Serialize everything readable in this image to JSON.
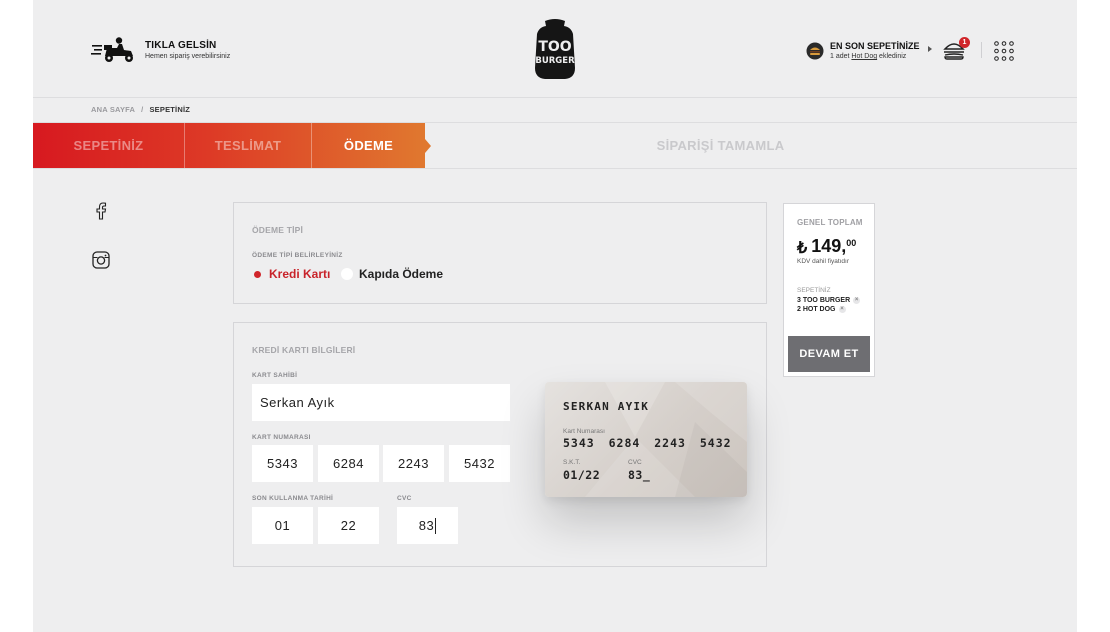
{
  "header": {
    "delivery_title": "TIKLA GELSİN",
    "delivery_sub": "Hemen sipariş verebilirsiniz",
    "logo_line1": "TOO",
    "logo_line2": "BURGER",
    "last_cart_title": "EN SON SEPETİNİZE",
    "last_cart_sub_pre": "1 adet ",
    "last_cart_sub_item": "Hot Dog",
    "last_cart_sub_post": " eklediniz",
    "cart_count": "1",
    "icons": [
      "scooter-icon",
      "burger-avatar-icon",
      "arrow-right-icon",
      "burger-cart-icon",
      "grid-menu-icon"
    ]
  },
  "breadcrumb": {
    "home": "ANA SAYFA",
    "sep": "/",
    "current": "SEPETİNİZ"
  },
  "steps": [
    {
      "label": "SEPETİNİZ",
      "state": "done"
    },
    {
      "label": "TESLİMAT",
      "state": "done"
    },
    {
      "label": "ÖDEME",
      "state": "active"
    },
    {
      "label": "SİPARİŞİ TAMAMLA",
      "state": "pending"
    }
  ],
  "payment_type": {
    "title": "ÖDEME TİPİ",
    "subtitle": "ÖDEME TİPİ BELİRLEYİNİZ",
    "options": [
      {
        "label": "Kredi Kartı",
        "selected": true
      },
      {
        "label": "Kapıda Ödeme",
        "selected": false
      }
    ]
  },
  "card_info": {
    "title": "KREDİ KARTI BİLGİLERİ",
    "holder_label": "KART SAHİBİ",
    "holder_value": "Serkan Ayık",
    "number_label": "KART NUMARASI",
    "number_parts": [
      "5343",
      "6284",
      "2243",
      "5432"
    ],
    "expiry_label": "SON KULLANMA TARİHİ",
    "expiry_month": "01",
    "expiry_year": "22",
    "cvc_label": "CVC",
    "cvc_value": "83"
  },
  "card_preview": {
    "name": "SERKAN AYIK",
    "number_label": "Kart Numarası",
    "number": "5343 6284 2243 5432",
    "expiry_label": "S.K.T.",
    "expiry": "01/22",
    "cvc_label": "CVC",
    "cvc": "83_"
  },
  "summary": {
    "title": "GENEL TOPLAM",
    "currency": "₺",
    "price_int": "149,",
    "price_dec": "00",
    "kdv": "KDV dahil fiyatıdır",
    "cart_label": "SEPETİNİZ",
    "items": [
      "3 TOO BURGER",
      "2 HOT DOG"
    ],
    "button": "DEVAM ET"
  },
  "social": [
    "facebook-icon",
    "instagram-icon"
  ],
  "colors": {
    "accent": "#d0252a",
    "accent_end": "#e0782f",
    "button": "#6e6e72",
    "background": "#eeeeef"
  }
}
